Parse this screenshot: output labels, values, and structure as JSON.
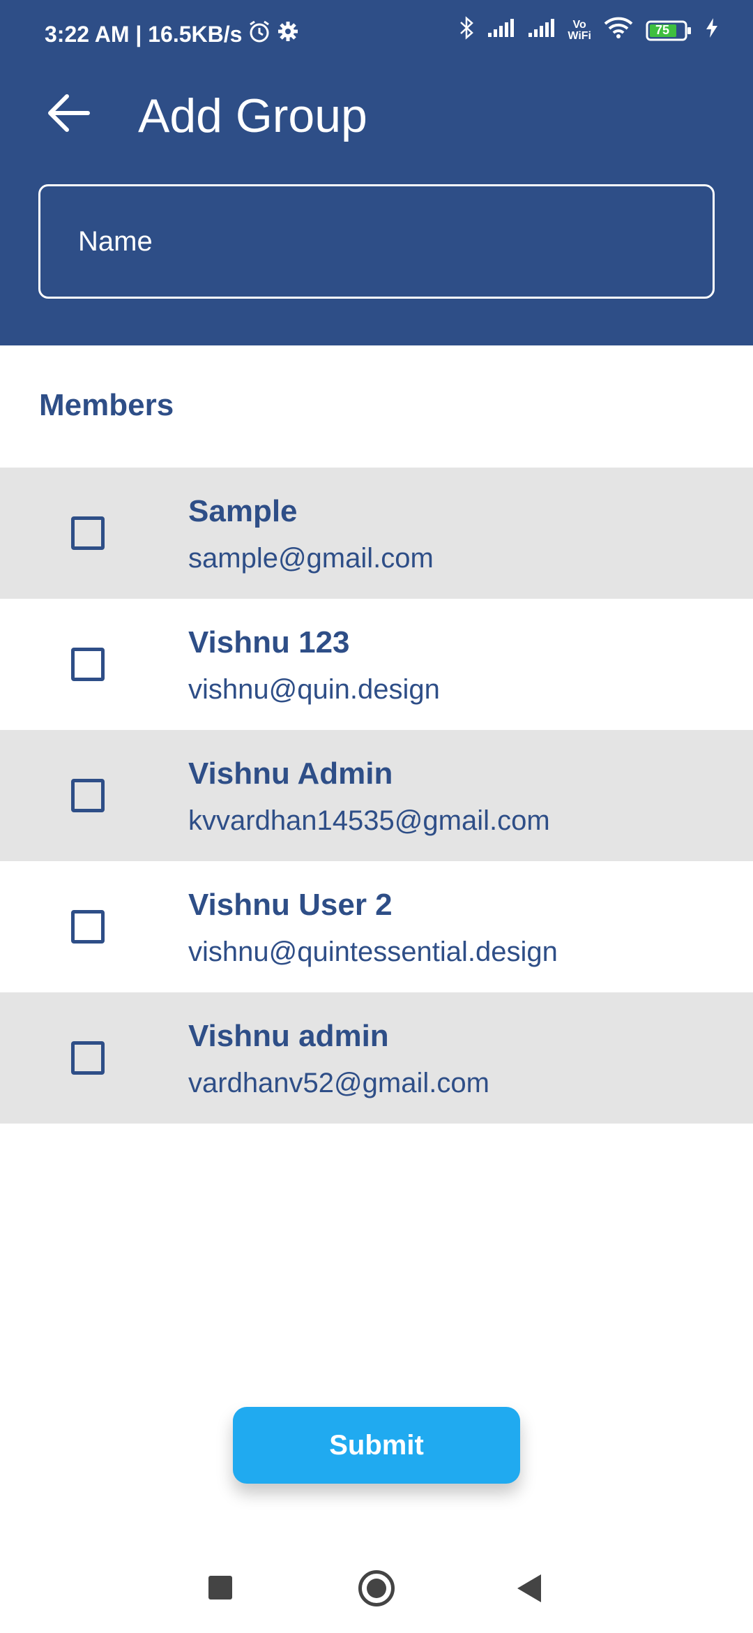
{
  "status_bar": {
    "time_speed": "3:22 AM | 16.5KB/s",
    "battery_level": "75",
    "icons": [
      "alarm-icon",
      "settings-gear-icon",
      "bluetooth-icon",
      "signal-icon",
      "signal-icon",
      "vowifi-icon",
      "wifi-icon",
      "battery-icon",
      "charging-icon"
    ],
    "vowifi_line1": "Vo",
    "vowifi_line2": "WiFi"
  },
  "app_bar": {
    "title": "Add Group",
    "back_icon": "arrow-left-icon"
  },
  "name_field": {
    "placeholder": "Name",
    "value": ""
  },
  "members": {
    "heading": "Members",
    "items": [
      {
        "name": "Sample",
        "email": "sample@gmail.com",
        "checked": false
      },
      {
        "name": "Vishnu 123",
        "email": "vishnu@quin.design",
        "checked": false
      },
      {
        "name": "Vishnu Admin",
        "email": "kvvardhan14535@gmail.com",
        "checked": false
      },
      {
        "name": "Vishnu User 2",
        "email": "vishnu@quintessential.design",
        "checked": false
      },
      {
        "name": "Vishnu admin",
        "email": "vardhanv52@gmail.com",
        "checked": false
      }
    ]
  },
  "submit": {
    "label": "Submit"
  },
  "colors": {
    "primary": "#2e4e87",
    "accent": "#20aaf0",
    "row_shade": "#e4e4e4"
  }
}
